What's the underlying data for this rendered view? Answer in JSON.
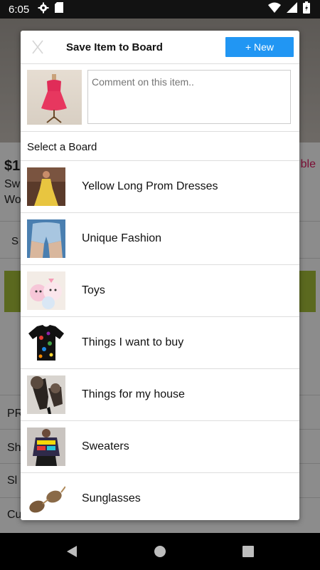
{
  "status_bar": {
    "time": "6:05",
    "icons_left": [
      "gear-icon",
      "sd-card-icon"
    ],
    "icons_right": [
      "wifi-icon",
      "signal-icon",
      "battery-icon"
    ]
  },
  "background_app": {
    "price_fragment": "$1",
    "subtitle_fragment_1": "Sw",
    "subtitle_fragment_2": "Wo",
    "pink_fragment": "ble",
    "size_fragment": "S",
    "row_fragments": [
      "PR",
      "Sh",
      "Sl",
      "Cu"
    ],
    "accent_green": "#a6c03a"
  },
  "modal": {
    "close_label": "X",
    "title": "Save Item to Board",
    "new_button_label": "+ New",
    "new_button_color": "#2196f3",
    "comment_placeholder": "Comment on this item..",
    "select_label": "Select a Board",
    "boards": [
      {
        "label": "Yellow Long Prom Dresses",
        "thumb": "yellow-dress-image"
      },
      {
        "label": "Unique Fashion",
        "thumb": "denim-shorts-image"
      },
      {
        "label": "Toys",
        "thumb": "plush-toys-image"
      },
      {
        "label": "Things I want to buy",
        "thumb": "printed-tshirt-image"
      },
      {
        "label": "Things for my house",
        "thumb": "fur-heels-image"
      },
      {
        "label": "Sweaters",
        "thumb": "graphic-sweater-image"
      },
      {
        "label": "Sunglasses",
        "thumb": "sunglasses-image"
      }
    ]
  },
  "nav_bar": {
    "icons": [
      "back-icon",
      "home-icon",
      "recents-icon"
    ]
  }
}
